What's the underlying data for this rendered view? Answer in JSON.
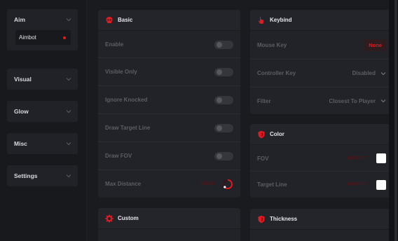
{
  "sidebar": {
    "groups": [
      {
        "label": "Aim",
        "sub": {
          "label": "Aimbot"
        }
      },
      {
        "label": "Visual"
      },
      {
        "label": "Glow"
      },
      {
        "label": "Misc"
      },
      {
        "label": "Settings"
      }
    ]
  },
  "basic": {
    "title": "Basic",
    "rows": {
      "enable": "Enable",
      "visible_only": "Visible Only",
      "ignore_knocked": "Ignore Knocked",
      "draw_target_line": "Draw Target Line",
      "draw_fov": "Draw FOV",
      "max_distance": "Max Distance"
    },
    "max_distance_value": "150.00"
  },
  "custom": {
    "title": "Custom"
  },
  "keybind": {
    "title": "Keybind",
    "mouse_key": {
      "label": "Mouse Key",
      "value": "None"
    },
    "controller_key": {
      "label": "Controller Key",
      "value": "Disabled"
    },
    "filter": {
      "label": "Filter",
      "value": "Closest To Player"
    }
  },
  "color": {
    "title": "Color",
    "fov": {
      "label": "FOV",
      "hex": "#FFFFFF"
    },
    "target_line": {
      "label": "Target Line",
      "hex": "#FFFFFF"
    }
  },
  "thickness": {
    "title": "Thickness"
  },
  "theme": {
    "accent": "#e11b22",
    "background": "#1a1b1f",
    "panel": "#222328"
  }
}
